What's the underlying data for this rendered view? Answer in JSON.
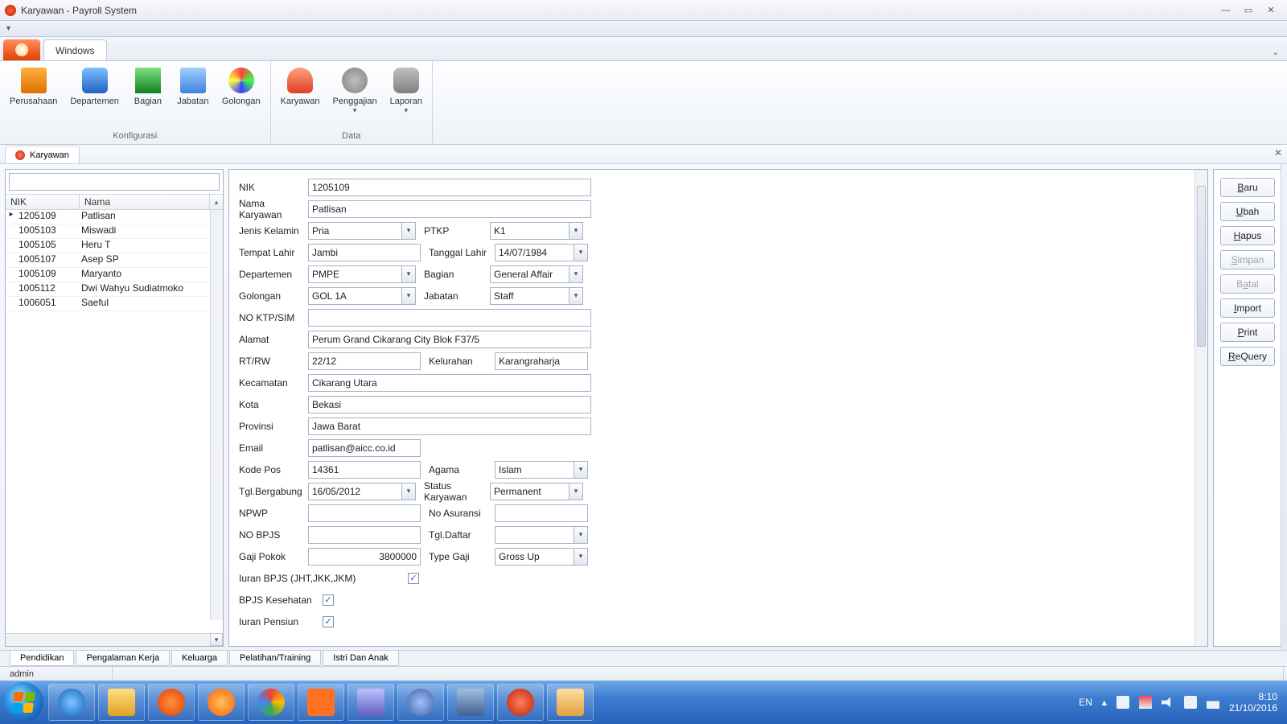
{
  "window": {
    "title": "Karyawan - Payroll System"
  },
  "ribbon": {
    "tab": "Windows",
    "groups": {
      "konfigurasi": {
        "label": "Konfigurasi",
        "items": [
          "Perusahaan",
          "Departemen",
          "Bagian",
          "Jabatan",
          "Golongan"
        ]
      },
      "data": {
        "label": "Data",
        "items": [
          "Karyawan",
          "Penggajian",
          "Laporan"
        ]
      }
    }
  },
  "docTab": "Karyawan",
  "grid": {
    "headers": {
      "nik": "NIK",
      "nama": "Nama"
    },
    "rows": [
      {
        "nik": "1205109",
        "nama": "Patlisan",
        "sel": true
      },
      {
        "nik": "1005103",
        "nama": "Miswadi"
      },
      {
        "nik": "1005105",
        "nama": "Heru T"
      },
      {
        "nik": "1005107",
        "nama": "Asep SP"
      },
      {
        "nik": "1005109",
        "nama": "Maryanto"
      },
      {
        "nik": "1005112",
        "nama": "Dwi Wahyu Sudiatmoko"
      },
      {
        "nik": "1006051",
        "nama": "Saeful"
      }
    ]
  },
  "form": {
    "labels": {
      "nik": "NIK",
      "nama": "Nama Karyawan",
      "jk": "Jenis Kelamin",
      "ptkp": "PTKP",
      "tplahir": "Tempat Lahir",
      "tglahir": "Tanggal Lahir",
      "dept": "Departemen",
      "bagian": "Bagian",
      "gol": "Golongan",
      "jabatan": "Jabatan",
      "ktp": "NO KTP/SIM",
      "alamat": "Alamat",
      "rtrw": "RT/RW",
      "kel": "Kelurahan",
      "kec": "Kecamatan",
      "kota": "Kota",
      "prov": "Provinsi",
      "email": "Email",
      "kodepos": "Kode Pos",
      "agama": "Agama",
      "tglgabung": "Tgl.Bergabung",
      "status": "Status Karyawan",
      "npwp": "NPWP",
      "noasur": "No Asuransi",
      "nobpjs": "NO BPJS",
      "tgldaftar": "Tgl.Daftar",
      "gaji": "Gaji Pokok",
      "typegaji": "Type Gaji",
      "iuranbpjs": "Iuran BPJS (JHT,JKK,JKM)",
      "bpjskes": "BPJS Kesehatan",
      "iuranpensiun": "Iuran Pensiun"
    },
    "values": {
      "nik": "1205109",
      "nama": "Patlisan",
      "jk": "Pria",
      "ptkp": "K1",
      "tplahir": "Jambi",
      "tglahir": "14/07/1984",
      "dept": "PMPE",
      "bagian": "General Affair",
      "gol": "GOL 1A",
      "jabatan": "Staff",
      "ktp": "",
      "alamat": "Perum Grand Cikarang City Blok F37/5",
      "rtrw": "22/12",
      "kel": "Karangraharja",
      "kec": "Cikarang Utara",
      "kota": "Bekasi",
      "prov": "Jawa Barat",
      "email": "patlisan@aicc.co.id",
      "kodepos": "14361",
      "agama": "Islam",
      "tglgabung": "16/05/2012",
      "status": "Permanent",
      "npwp": "",
      "noasur": "",
      "nobpjs": "",
      "tgldaftar": "",
      "gaji": "3800000",
      "typegaji": "Gross Up",
      "iuranbpjs": true,
      "bpjskes": true,
      "iuranpensiun": true
    }
  },
  "buttons": {
    "baru": "Baru",
    "ubah": "Ubah",
    "hapus": "Hapus",
    "simpan": "Simpan",
    "batal": "Batal",
    "import": "Import",
    "print": "Print",
    "requery": "ReQuery"
  },
  "bottomTabs": [
    "Pendidikan",
    "Pengalaman Kerja",
    "Keluarga",
    "Pelatihan/Training",
    "Istri Dan Anak"
  ],
  "status": {
    "user": "admin"
  },
  "tray": {
    "lang": "EN",
    "time": "8:10",
    "date": "21/10/2016"
  }
}
